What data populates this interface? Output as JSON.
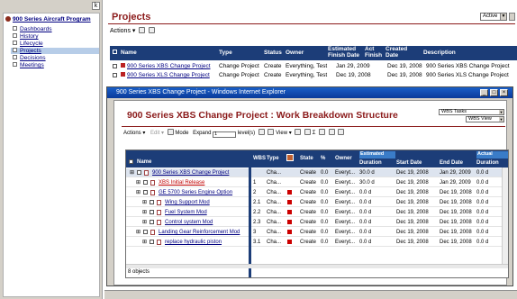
{
  "nav": {
    "corner_label": "k",
    "root_label": "900 Series Aircraft Program",
    "items": [
      {
        "label": "Dashboards",
        "selected": false
      },
      {
        "label": "History",
        "selected": false
      },
      {
        "label": "Lifecycle",
        "selected": false
      },
      {
        "label": "Projects",
        "selected": true
      },
      {
        "label": "Decisions",
        "selected": false
      },
      {
        "label": "Meetings",
        "selected": false
      }
    ]
  },
  "projects": {
    "title": "Projects",
    "filter_value": "Active",
    "actions_label": "Actions ▾",
    "columns": [
      "Name",
      "Type",
      "Status",
      "Owner",
      "Estimated Finish Date",
      "Act Finish",
      "Created Date",
      "Description"
    ],
    "rows": [
      {
        "name": "900 Series XBS Change Project",
        "type": "Change Project",
        "status": "Create",
        "owner": "Everything, Test",
        "est_finish": "Jan 29, 2009",
        "act_finish": "",
        "created": "Dec 19, 2008",
        "description": "900 Series XBS Change Project"
      },
      {
        "name": "900 Series XLS Change Project",
        "type": "Change Project",
        "status": "Create",
        "owner": "Everything, Test",
        "est_finish": "Dec 19, 2008",
        "act_finish": "",
        "created": "Dec 19, 2008",
        "description": "900 Series XLS Change Project"
      }
    ]
  },
  "popup": {
    "window_title": "900 Series XBS Change Project - Windows Internet Explorer",
    "heading": "900 Series XBS Change Project : Work Breakdown Structure",
    "wbs_select": "WBS Tasks",
    "view_select": "WBS View",
    "toolbar": {
      "actions": "Actions ▾",
      "edit": "Edit ▾",
      "mode": "Mode",
      "expand": "Expand",
      "expand_value": "1",
      "levels": "level(s)",
      "view": "View ▾",
      "sigma": "Σ"
    },
    "grid": {
      "col_name": "Name",
      "col_wbs": "WBS",
      "col_type": "Type",
      "col_state": "State",
      "col_pct": "%",
      "col_owner": "Owner",
      "col_est_group": "Estimated",
      "col_duration": "Duration",
      "col_start": "Start Date",
      "col_end": "End Date",
      "col_act_group": "Actual",
      "col_act_duration": "Duration",
      "rows": [
        {
          "name": "900 Series XBS Change Project",
          "wbs": "",
          "type": "Cha...",
          "state": "Create",
          "pct": "0.0",
          "owner": "Everyt...",
          "duration": "30.0 d",
          "start": "Dec 19, 2008",
          "end": "Jan 29, 2009",
          "act": "0.0 d",
          "flag": false,
          "indent": 0,
          "style": "lnk"
        },
        {
          "name": "XBS Initial Release",
          "wbs": "1",
          "type": "Cha...",
          "state": "Create",
          "pct": "0.0",
          "owner": "Everyt...",
          "duration": "30.0 d",
          "start": "Dec 19, 2008",
          "end": "Jan 29, 2009",
          "act": "0.0 d",
          "flag": false,
          "indent": 1,
          "style": "red"
        },
        {
          "name": "GE 5700 Series Engine Option",
          "wbs": "2",
          "type": "Cha...",
          "state": "Create",
          "pct": "0.0",
          "owner": "Everyt...",
          "duration": "0.0 d",
          "start": "Dec 19, 2008",
          "end": "Dec 19, 2008",
          "act": "0.0 d",
          "flag": true,
          "indent": 1,
          "style": "lnk"
        },
        {
          "name": "Wing Support Mod",
          "wbs": "2.1",
          "type": "Cha...",
          "state": "Create",
          "pct": "0.0",
          "owner": "Everyt...",
          "duration": "0.0 d",
          "start": "Dec 19, 2008",
          "end": "Dec 19, 2008",
          "act": "0.0 d",
          "flag": true,
          "indent": 2,
          "style": "lnk"
        },
        {
          "name": "Fuel System Mod",
          "wbs": "2.2",
          "type": "Cha...",
          "state": "Create",
          "pct": "0.0",
          "owner": "Everyt...",
          "duration": "0.0 d",
          "start": "Dec 19, 2008",
          "end": "Dec 19, 2008",
          "act": "0.0 d",
          "flag": true,
          "indent": 2,
          "style": "lnk"
        },
        {
          "name": "Control system Mod",
          "wbs": "2.3",
          "type": "Cha...",
          "state": "Create",
          "pct": "0.0",
          "owner": "Everyt...",
          "duration": "0.0 d",
          "start": "Dec 19, 2008",
          "end": "Dec 19, 2008",
          "act": "0.0 d",
          "flag": true,
          "indent": 2,
          "style": "lnk"
        },
        {
          "name": "Landing Gear Reinforcement Mod",
          "wbs": "3",
          "type": "Cha...",
          "state": "Create",
          "pct": "0.0",
          "owner": "Everyt...",
          "duration": "0.0 d",
          "start": "Dec 19, 2008",
          "end": "Dec 19, 2008",
          "act": "0.0 d",
          "flag": true,
          "indent": 1,
          "style": "lnk"
        },
        {
          "name": "replace hydraulic piston",
          "wbs": "3.1",
          "type": "Cha...",
          "state": "Create",
          "pct": "0.0",
          "owner": "Everyt...",
          "duration": "0.0 d",
          "start": "Dec 19, 2008",
          "end": "Dec 19, 2008",
          "act": "0.0 d",
          "flag": true,
          "indent": 2,
          "style": "lnk"
        }
      ],
      "footer": "8 objects"
    }
  }
}
